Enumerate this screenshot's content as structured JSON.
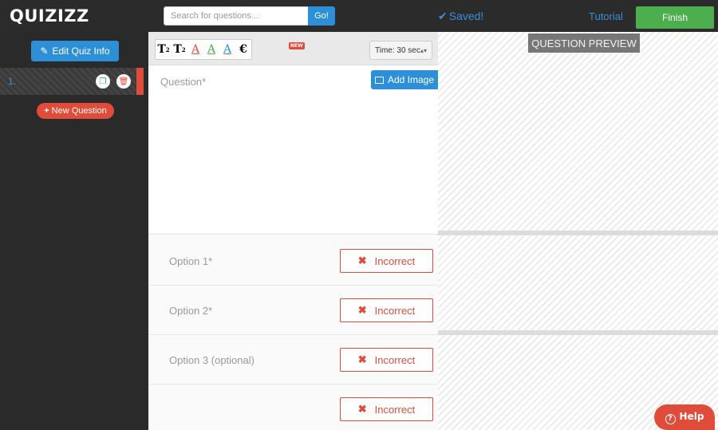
{
  "header": {
    "logo": "QUIZIZZ",
    "search": {
      "placeholder": "Search for questions...",
      "button_label": "Go!"
    },
    "saved_status": "Saved!",
    "tutorial_link": "Tutorial",
    "finish_label": "Finish"
  },
  "sidebar": {
    "edit_quiz_info_label": "Edit Quiz Info",
    "questions": [
      {
        "number": "1."
      }
    ],
    "new_question_label": "New Question"
  },
  "editor": {
    "toolbar": {
      "new_badge": "NEW",
      "time_select": "Time: 30 sec"
    },
    "question_placeholder": "Question*",
    "add_image_label": "Add Image",
    "options": [
      {
        "placeholder": "Option 1*",
        "status": "Incorrect"
      },
      {
        "placeholder": "Option 2*",
        "status": "Incorrect"
      },
      {
        "placeholder": "Option 3 (optional)",
        "status": "Incorrect"
      },
      {
        "placeholder": "",
        "status": "Incorrect"
      }
    ]
  },
  "preview": {
    "title": "QUESTION PREVIEW",
    "help_label": "Help"
  },
  "colors": {
    "topbar": "#2b2b2b",
    "primary_blue": "#2d8fd8",
    "danger_red": "#e04b3a",
    "success_green": "#4cae4c"
  }
}
